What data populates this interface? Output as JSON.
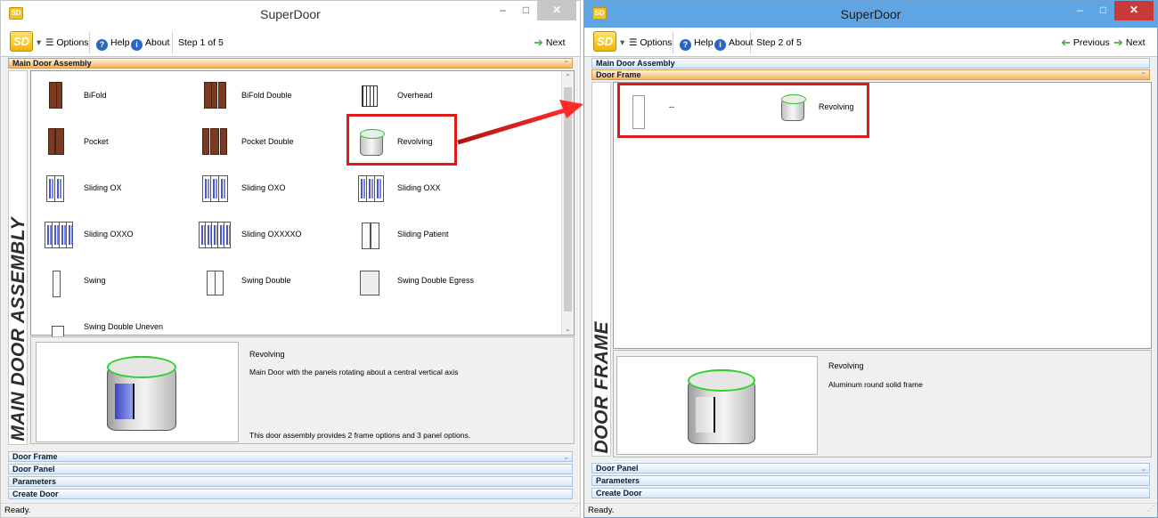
{
  "left": {
    "title": "SuperDoor",
    "toolbar": {
      "options": "Options",
      "help": "Help",
      "about": "About",
      "step": "Step 1 of 5",
      "next": "Next"
    },
    "section_main": "Main Door Assembly",
    "band_label": "MAIN DOOR ASSEMBLY",
    "items": [
      {
        "label": "BiFold",
        "icon": "bifold-door-icon"
      },
      {
        "label": "BiFold Double",
        "icon": "bifold-double-door-icon"
      },
      {
        "label": "Overhead",
        "icon": "overhead-door-icon"
      },
      {
        "label": "Pocket",
        "icon": "pocket-door-icon"
      },
      {
        "label": "Pocket Double",
        "icon": "pocket-double-door-icon"
      },
      {
        "label": "Revolving",
        "icon": "revolving-door-icon"
      },
      {
        "label": "Sliding OX",
        "icon": "sliding-door-icon"
      },
      {
        "label": "Sliding OXO",
        "icon": "sliding-door-icon"
      },
      {
        "label": "Sliding OXX",
        "icon": "sliding-door-icon"
      },
      {
        "label": "Sliding OXXO",
        "icon": "sliding-door-icon"
      },
      {
        "label": "Sliding OXXXXO",
        "icon": "sliding-door-icon"
      },
      {
        "label": "Sliding Patient",
        "icon": "sliding-patient-door-icon"
      },
      {
        "label": "Swing",
        "icon": "swing-door-icon"
      },
      {
        "label": "Swing Double",
        "icon": "swing-double-door-icon"
      },
      {
        "label": "Swing Double Egress",
        "icon": "swing-double-egress-door-icon"
      },
      {
        "label": "Swing Double Uneven",
        "icon": "swing-double-uneven-door-icon"
      }
    ],
    "desc": {
      "name": "Revolving",
      "line1": "Main Door with the panels rotating about a central vertical axis",
      "line2": "This door assembly provides 2 frame options and 3 panel options."
    },
    "sections": [
      "Door Frame",
      "Door Panel",
      "Parameters",
      "Create Door"
    ],
    "status": "Ready."
  },
  "right": {
    "title": "SuperDoor",
    "toolbar": {
      "options": "Options",
      "help": "Help",
      "about": "About",
      "step": "Step 2 of 5",
      "previous": "Previous",
      "next": "Next"
    },
    "section_main": "Main Door Assembly",
    "section_frame": "Door Frame",
    "band_label": "DOOR FRAME",
    "items": [
      {
        "label": "--",
        "icon": "blank-frame-icon"
      },
      {
        "label": "Revolving",
        "icon": "revolving-frame-icon"
      }
    ],
    "desc": {
      "name": "Revolving",
      "line1": "Aluminum round solid frame"
    },
    "sections": [
      "Door Panel",
      "Parameters",
      "Create Door"
    ],
    "status": "Ready."
  },
  "colors": {
    "highlight": "#dd1b1b",
    "active_section": "#f5b45c",
    "titlebar_active": "#5fa5e4"
  }
}
